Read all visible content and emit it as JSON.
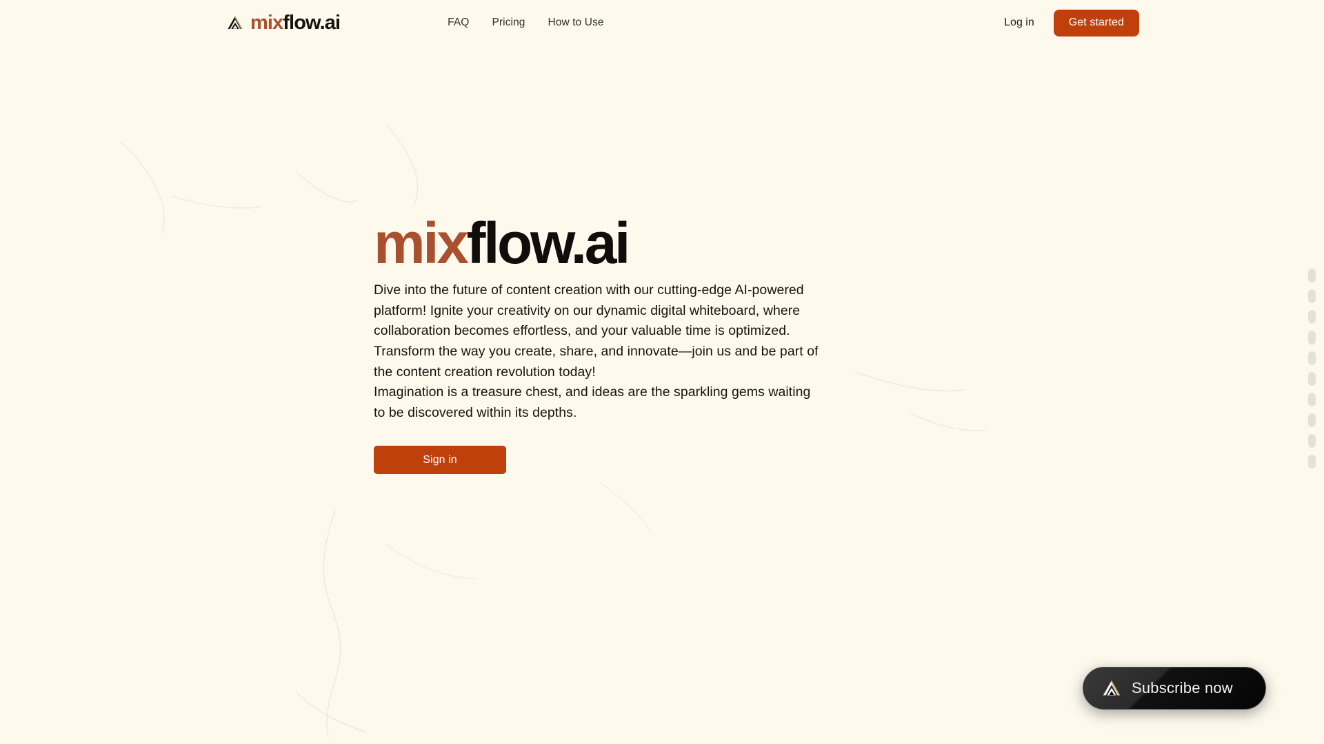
{
  "theme": {
    "background": "#FDF9ED",
    "accent_orange": "#C0400C",
    "brand_rust": "#A9502E",
    "ink": "#100D0B",
    "logo_gold": "#C9A96A",
    "scroll_segment": "#E3E2D6"
  },
  "header": {
    "logo": {
      "icon": "mountain-chevron-icon",
      "text_primary": "mix",
      "text_secondary": "flow.ai"
    },
    "nav": [
      {
        "label": "FAQ"
      },
      {
        "label": "Pricing"
      },
      {
        "label": "How to Use"
      }
    ],
    "login_label": "Log in",
    "get_started_label": "Get started"
  },
  "hero": {
    "title_primary": "mix",
    "title_secondary": "flow.ai",
    "paragraphs": [
      "Dive into the future of content creation with our cutting-edge AI-powered platform! Ignite your creativity on our dynamic digital whiteboard, where collaboration becomes effortless, and your valuable time is optimized. Transform the way you create, share, and innovate—join us and be part of the content creation revolution today!",
      "Imagination is a treasure chest, and ideas are the sparkling gems waiting to be discovered within its depths."
    ],
    "sign_in_label": "Sign in"
  },
  "scroll_indicator": {
    "segment_count": 10
  },
  "subscribe_widget": {
    "icon": "mountain-chevron-icon",
    "label": "Subscribe now"
  }
}
